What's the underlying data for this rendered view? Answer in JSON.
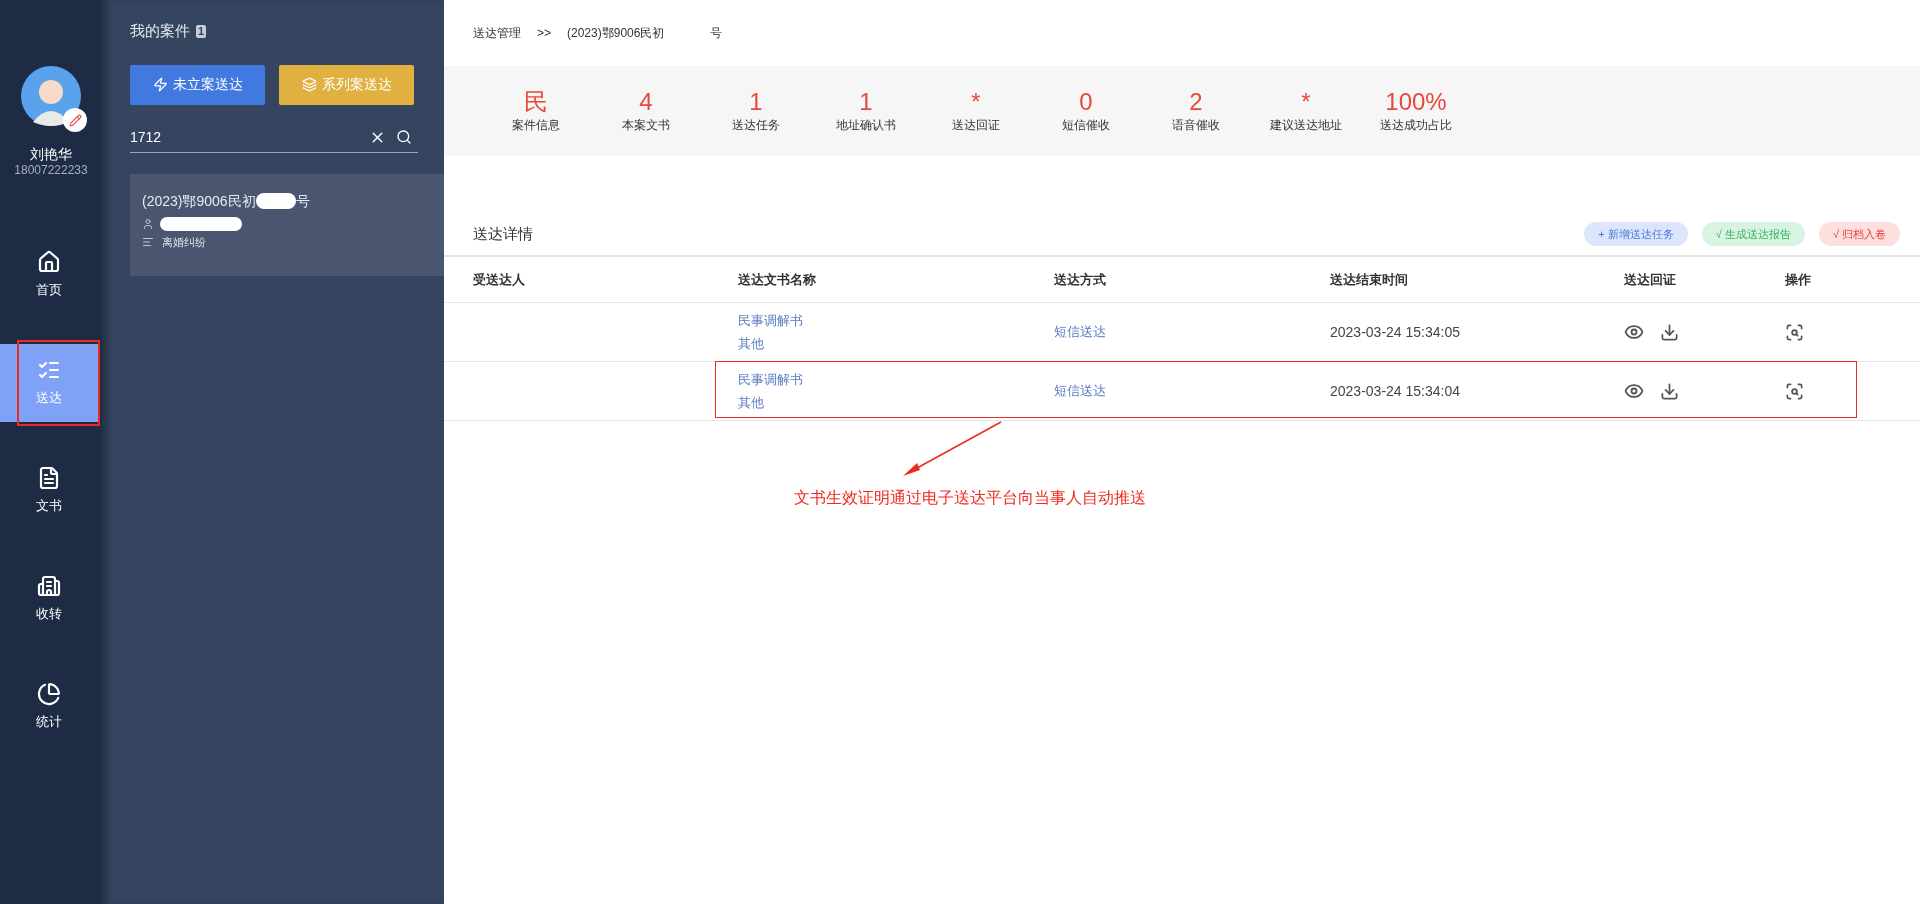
{
  "nav": {
    "user": {
      "name": "刘艳华",
      "phone": "18007222233"
    },
    "items": [
      {
        "label": "首页",
        "kind": "home",
        "selected": false
      },
      {
        "label": "送达",
        "kind": "delivery",
        "selected": true
      },
      {
        "label": "文书",
        "kind": "document",
        "selected": false
      },
      {
        "label": "收转",
        "kind": "transfer",
        "selected": false
      },
      {
        "label": "统计",
        "kind": "statistics",
        "selected": false
      }
    ]
  },
  "cases": {
    "title": "我的案件",
    "count": "1",
    "buttons": [
      {
        "label": "未立案送达",
        "kind": "primary"
      },
      {
        "label": "系列案送达",
        "kind": "warning"
      }
    ],
    "search": {
      "value": "1712"
    },
    "items": [
      {
        "title_start": "(2023)鄂9006民初",
        "title_end": "号",
        "category": "离婚纠纷",
        "selected": true
      }
    ]
  },
  "breadcrumb": [
    "送达管理",
    ">>",
    "(2023)鄂9006民初",
    "号"
  ],
  "stats": [
    {
      "value": "民",
      "label": "案件信息"
    },
    {
      "value": "4",
      "label": "本案文书"
    },
    {
      "value": "1",
      "label": "送达任务"
    },
    {
      "value": "1",
      "label": "地址确认书"
    },
    {
      "value": "*",
      "label": "送达回证"
    },
    {
      "value": "0",
      "label": "短信催收"
    },
    {
      "value": "2",
      "label": "语音催收"
    },
    {
      "value": "*",
      "label": "建议送达地址"
    },
    {
      "value": "100%",
      "label": "送达成功占比"
    }
  ],
  "details": {
    "title": "送达详情",
    "actions": [
      {
        "label": "+ 新增送达任务",
        "kind": "blue"
      },
      {
        "label": "√ 生成送达报告",
        "kind": "green"
      },
      {
        "label": "√ 归档入卷",
        "kind": "red"
      }
    ],
    "columns": [
      "受送达人",
      "送达文书名称",
      "送达方式",
      "送达结束时间",
      "送达回证",
      "操作"
    ],
    "rows": [
      {
        "documents": [
          "民事调解书",
          "其他"
        ],
        "method": "短信送达",
        "end_time": "2023-03-24 15:34:05",
        "highlighted": false
      },
      {
        "documents": [
          "民事调解书",
          "其他"
        ],
        "method": "短信送达",
        "end_time": "2023-03-24 15:34:04",
        "highlighted": true
      }
    ]
  },
  "annotation": {
    "text": "文书生效证明通过电子送达平台向当事人自动推送"
  }
}
